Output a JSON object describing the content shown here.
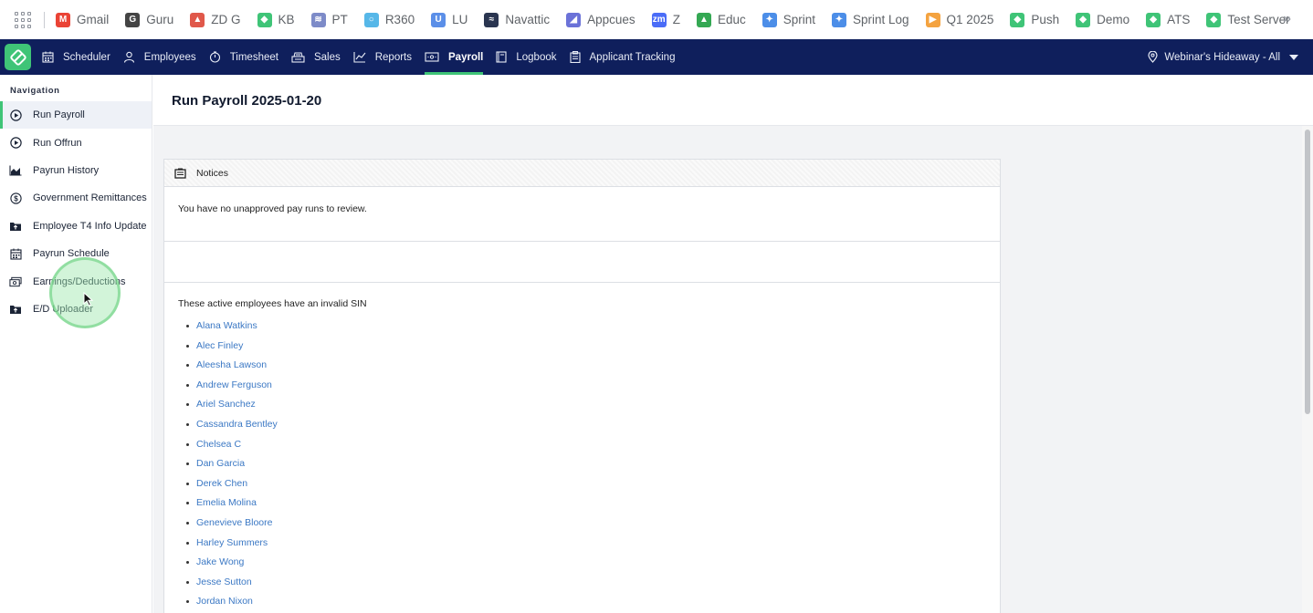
{
  "bookmarks": [
    {
      "label": "Gmail",
      "icon": "gmail-icon",
      "color": "#ea4335",
      "glyph": "M"
    },
    {
      "label": "Guru",
      "icon": "guru-icon",
      "color": "#444444",
      "glyph": "G"
    },
    {
      "label": "ZD G",
      "icon": "zendesk-icon",
      "color": "#e0584a",
      "glyph": "▲"
    },
    {
      "label": "KB",
      "icon": "kb-icon",
      "color": "#3fc477",
      "glyph": "◆"
    },
    {
      "label": "PT",
      "icon": "pt-icon",
      "color": "#7d8bc8",
      "glyph": "≋"
    },
    {
      "label": "R360",
      "icon": "r360-icon",
      "color": "#56b7e8",
      "glyph": "○"
    },
    {
      "label": "LU",
      "icon": "lu-icon",
      "color": "#5b8fe8",
      "glyph": "U"
    },
    {
      "label": "Navattic",
      "icon": "navattic-icon",
      "color": "#2a3550",
      "glyph": "≈"
    },
    {
      "label": "Appcues",
      "icon": "appcues-icon",
      "color": "#6b72d8",
      "glyph": "◢"
    },
    {
      "label": "Z",
      "icon": "zoom-icon",
      "color": "#4a6cf7",
      "glyph": "zm"
    },
    {
      "label": "Educ",
      "icon": "drive-icon",
      "color": "#34a853",
      "glyph": "▲"
    },
    {
      "label": "Sprint",
      "icon": "jira-icon",
      "color": "#4c8ee8",
      "glyph": "✦"
    },
    {
      "label": "Sprint Log",
      "icon": "jira-icon",
      "color": "#4c8ee8",
      "glyph": "✦"
    },
    {
      "label": "Q1 2025",
      "icon": "slides-icon",
      "color": "#f4a340",
      "glyph": "▶"
    },
    {
      "label": "Push",
      "icon": "push-icon",
      "color": "#3fc477",
      "glyph": "◆"
    },
    {
      "label": "Demo",
      "icon": "demo-icon",
      "color": "#3fc477",
      "glyph": "◆"
    },
    {
      "label": "ATS",
      "icon": "ats-icon",
      "color": "#3fc477",
      "glyph": "◆"
    },
    {
      "label": "Test Server",
      "icon": "test-server-icon",
      "color": "#3fc477",
      "glyph": "◆"
    }
  ],
  "bookmarks_more": "»",
  "topnav": {
    "items": [
      {
        "label": "Scheduler",
        "icon": "calendar-icon"
      },
      {
        "label": "Employees",
        "icon": "person-icon"
      },
      {
        "label": "Timesheet",
        "icon": "clock-icon"
      },
      {
        "label": "Sales",
        "icon": "register-icon"
      },
      {
        "label": "Reports",
        "icon": "chart-icon"
      },
      {
        "label": "Payroll",
        "icon": "money-icon",
        "active": true
      },
      {
        "label": "Logbook",
        "icon": "book-icon"
      },
      {
        "label": "Applicant Tracking",
        "icon": "clipboard-icon"
      }
    ],
    "location": "Webinar's Hideaway - All"
  },
  "sidebar": {
    "title": "Navigation",
    "items": [
      {
        "label": "Run Payroll",
        "icon": "play-circle-icon",
        "active": true
      },
      {
        "label": "Run Offrun",
        "icon": "play-circle-icon"
      },
      {
        "label": "Payrun History",
        "icon": "area-chart-icon"
      },
      {
        "label": "Government Remittances",
        "icon": "dollar-circle-icon"
      },
      {
        "label": "Employee T4 Info Update",
        "icon": "folder-upload-icon"
      },
      {
        "label": "Payrun Schedule",
        "icon": "calendar-icon"
      },
      {
        "label": "Earnings/Deductions",
        "icon": "cash-icon"
      },
      {
        "label": "E/D Uploader",
        "icon": "folder-upload-icon"
      }
    ]
  },
  "page": {
    "title": "Run Payroll 2025-01-20"
  },
  "notices": {
    "heading": "Notices",
    "no_unapproved": "You have no unapproved pay runs to review.",
    "invalid_sin_lead": "These active employees have an invalid SIN",
    "employees": [
      "Alana Watkins",
      "Alec Finley",
      "Aleesha Lawson",
      "Andrew Ferguson",
      "Ariel Sanchez",
      "Cassandra Bentley",
      "Chelsea C",
      "Dan Garcia",
      "Derek Chen",
      "Emelia Molina",
      "Genevieve Bloore",
      "Harley Summers",
      "Jake Wong",
      "Jesse Sutton",
      "Jordan Nixon"
    ]
  },
  "colors": {
    "nav_bg": "#0f1f5c",
    "accent": "#3fc477",
    "link": "#3b78c4"
  }
}
